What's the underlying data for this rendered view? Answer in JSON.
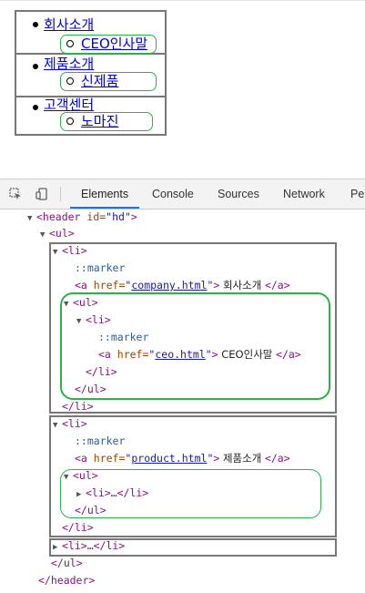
{
  "preview": {
    "items": [
      {
        "label": "회사소개",
        "sub": "CEO인사말"
      },
      {
        "label": "제품소개",
        "sub": "신제품"
      },
      {
        "label": "고객센터",
        "sub": "노마진"
      }
    ]
  },
  "devtools": {
    "tabs": [
      "Elements",
      "Console",
      "Sources",
      "Network",
      "Pe"
    ],
    "active_tab": "Elements",
    "icons": [
      "inspect-element-icon",
      "device-toolbar-icon"
    ],
    "colors": {
      "highlight_green": "#2bb24c",
      "box_gray": "#777777",
      "tab_active": "#1a73e8"
    },
    "lines": {
      "header_open": {
        "tag_open": "<header",
        "attr": " id=",
        "val": "\"hd\"",
        "close": ">"
      },
      "ul_open": "<ul>",
      "li1_open": "<li>",
      "marker1": "::marker",
      "a1": {
        "open": "<a",
        "attr": " href=",
        "q1": "\"",
        "href": "company.html",
        "q2": "\"",
        "gt": ">",
        "text": " 회사소개 ",
        "close": "</a>"
      },
      "ul1_open": "<ul>",
      "li1_1_open": "<li>",
      "marker1_1": "::marker",
      "a1_1": {
        "open": "<a",
        "attr": " href=",
        "q1": "\"",
        "href": "ceo.html",
        "q2": "\"",
        "gt": ">",
        "text": " CEO인사말 ",
        "close": "</a>"
      },
      "li1_1_close": "</li>",
      "ul1_close": "</ul>",
      "li1_close": "</li>",
      "li2_open": "<li>",
      "marker2": "::marker",
      "a2": {
        "open": "<a",
        "attr": " href=",
        "q1": "\"",
        "href": "product.html",
        "q2": "\"",
        "gt": ">",
        "text": " 제품소개 ",
        "close": "</a>"
      },
      "ul2_open": "<ul>",
      "li2_1_collapsed": "<li>…</li>",
      "ul2_close": "</ul>",
      "li2_close": "</li>",
      "li3_collapsed": "<li>…</li>",
      "ul_close": "</ul>",
      "header_close": "</header>"
    }
  }
}
